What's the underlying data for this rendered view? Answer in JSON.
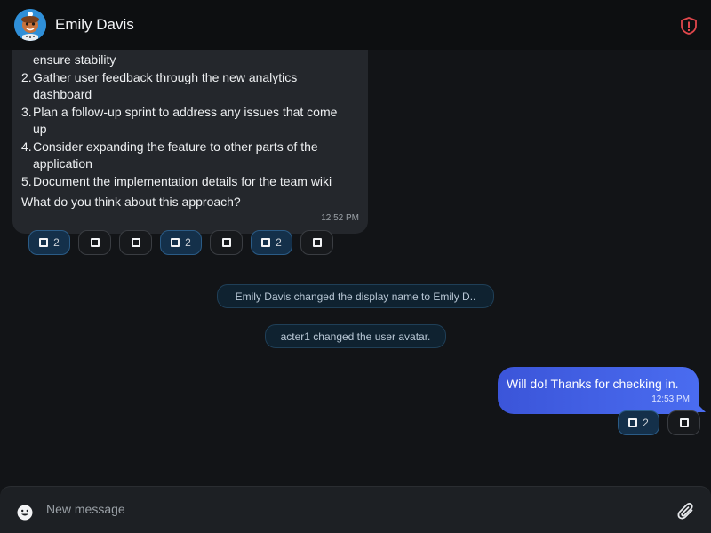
{
  "header": {
    "name": "Emily Davis",
    "avatar_icon": "avatar-cartoon-icon",
    "security_icon": "shield-alert-icon",
    "accent": "#e0474c"
  },
  "incoming": {
    "items": [
      {
        "num": "",
        "text": "ensure stability"
      },
      {
        "num": "2.",
        "text": "Gather user feedback through the new analytics"
      },
      {
        "num": "",
        "text": "dashboard"
      },
      {
        "num": "3.",
        "text": "Plan a follow-up sprint to address any issues that come"
      },
      {
        "num": "",
        "text": "up"
      },
      {
        "num": "4.",
        "text": "Consider expanding the feature to other parts of the"
      },
      {
        "num": "",
        "text": "application"
      },
      {
        "num": "5.",
        "text": "Document the implementation details for the team wiki"
      }
    ],
    "question": "What do you think about this approach?",
    "time": "12:52 PM",
    "reactions": [
      {
        "count": "2",
        "active": true
      },
      {
        "count": "",
        "active": false
      },
      {
        "count": "",
        "active": false
      },
      {
        "count": "2",
        "active": true
      },
      {
        "count": "",
        "active": false
      },
      {
        "count": "2",
        "active": true
      },
      {
        "count": "",
        "active": false
      }
    ]
  },
  "system_events": [
    "Emily Davis changed the display name to Emily D..",
    "acter1 changed the user avatar."
  ],
  "outgoing": {
    "text": "Will do! Thanks for checking in.",
    "time": "12:53 PM",
    "reactions": [
      {
        "count": "2",
        "active": true
      },
      {
        "count": "",
        "active": false
      }
    ],
    "color": "#4a6cf0"
  },
  "composer": {
    "placeholder": "New message",
    "emoji_icon": "emoji-icon",
    "attach_icon": "paperclip-icon"
  }
}
